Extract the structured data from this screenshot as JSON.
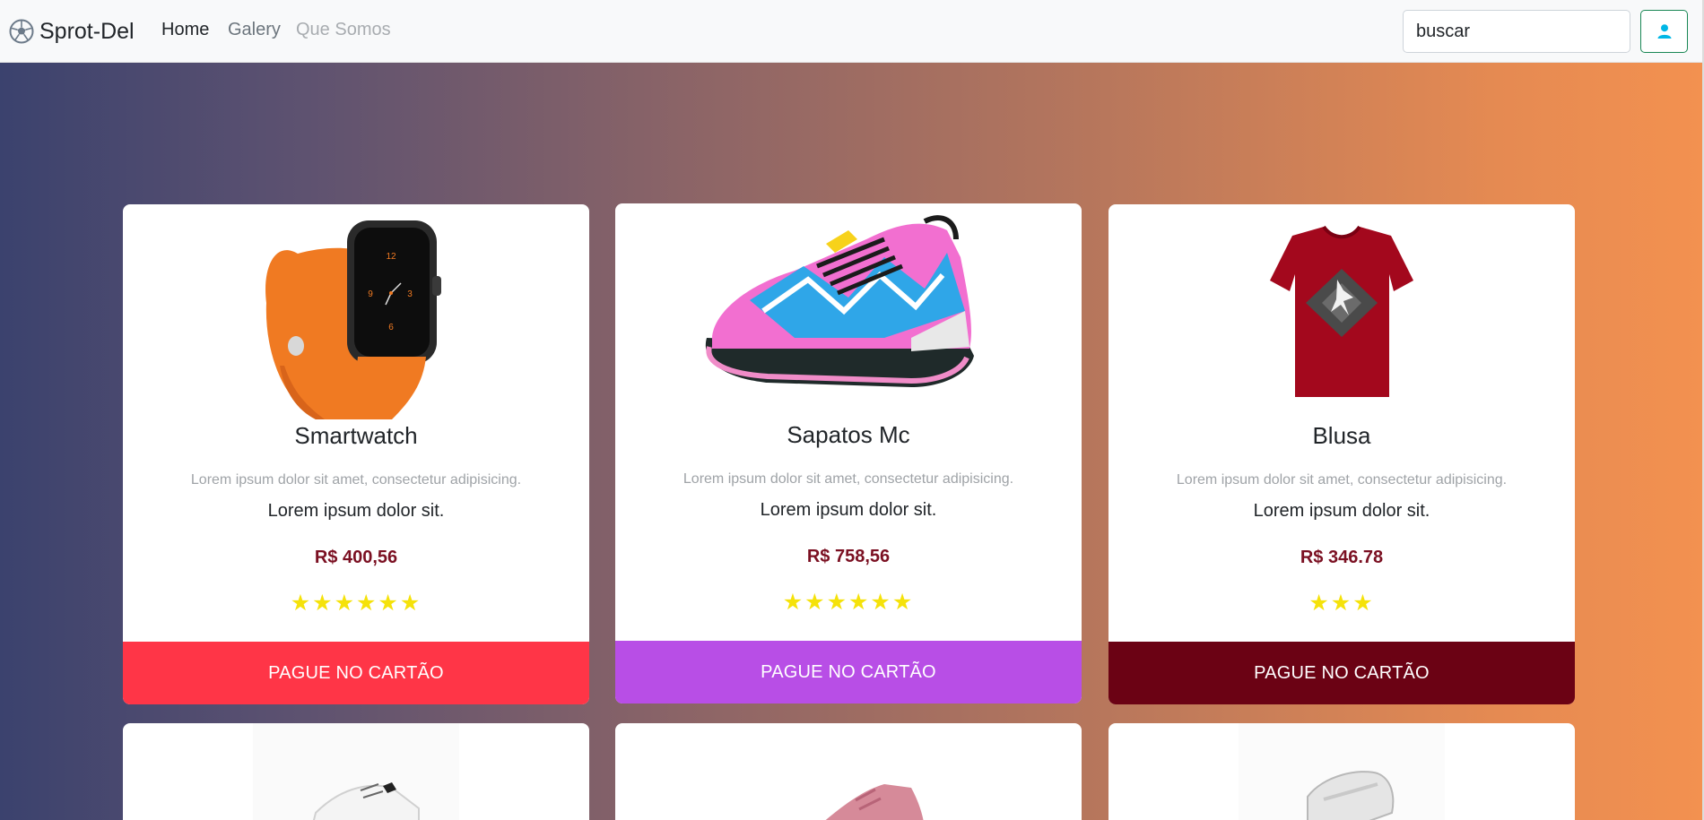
{
  "navbar": {
    "brand": "Sprot-Del",
    "links": [
      "Home",
      "Galery",
      "Que Somos"
    ],
    "search_value": "buscar",
    "user_icon": "person-icon"
  },
  "products": [
    {
      "title": "Smartwatch",
      "description": "Lorem ipsum dolor sit amet, consectetur adipisicing.",
      "subtitle": "Lorem ipsum dolor sit.",
      "price": "R$ 400,56",
      "rating": 6,
      "button": "PAGUE NO CARTÃO",
      "button_color": "#ff3547"
    },
    {
      "title": "Sapatos Mc",
      "description": "Lorem ipsum dolor sit amet, consectetur adipisicing.",
      "subtitle": "Lorem ipsum dolor sit.",
      "price": "R$ 758,56",
      "rating": 6,
      "button": "PAGUE NO CARTÃO",
      "button_color": "#b84ee6"
    },
    {
      "title": "Blusa",
      "description": "Lorem ipsum dolor sit amet, consectetur adipisicing.",
      "subtitle": "Lorem ipsum dolor sit.",
      "price": "R$ 346.78",
      "rating": 3,
      "button": "PAGUE NO CARTÃO",
      "button_color": "#6b0214"
    }
  ],
  "colors": {
    "price": "#7b1022",
    "stars": "#f5e20a",
    "user_button_border": "#198754",
    "user_icon": "#00b7e6"
  }
}
